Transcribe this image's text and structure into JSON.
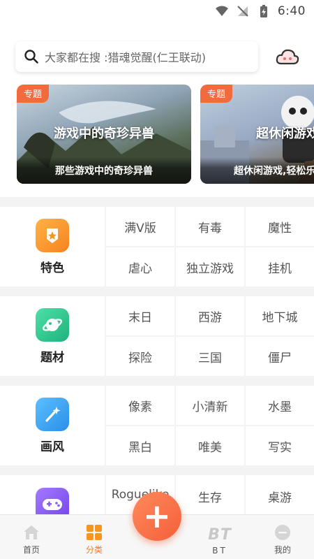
{
  "status_bar": {
    "time": "6:40"
  },
  "search": {
    "placeholder_text": "大家都在搜 :猎魂觉醒(仁王联动)"
  },
  "banners": [
    {
      "tag": "专题",
      "headline": "游戏中的奇珍异兽",
      "caption": "那些游戏中的奇珍异兽"
    },
    {
      "tag": "专题",
      "headline": "超休闲游戏",
      "caption": "超休闲游戏,轻松乐"
    }
  ],
  "sections": [
    {
      "title": "特色",
      "icon": "badge-icon",
      "color": "#f5961f",
      "tags": [
        "满V版",
        "有毒",
        "魔性",
        "虐心",
        "独立游戏",
        "挂机"
      ]
    },
    {
      "title": "题材",
      "icon": "planet-icon",
      "color": "#2cc58f",
      "tags": [
        "末日",
        "西游",
        "地下城",
        "探险",
        "三国",
        "僵尸"
      ]
    },
    {
      "title": "画风",
      "icon": "magic-wand-icon",
      "color": "#3aa0f0",
      "tags": [
        "像素",
        "小清新",
        "水墨",
        "黑白",
        "唯美",
        "写实"
      ]
    },
    {
      "title": "",
      "icon": "gamepad-icon",
      "color": "#8a5cf0",
      "tags": [
        "Roguelike",
        "生存",
        "桌游"
      ]
    }
  ],
  "bottom_nav": {
    "items": [
      {
        "label": "首页",
        "icon": "home-icon"
      },
      {
        "label": "分类",
        "icon": "category-grid-icon",
        "active": true
      },
      {
        "label": "BT",
        "icon": "bt-icon"
      },
      {
        "label": "我的",
        "icon": "profile-icon"
      }
    ],
    "fab": "+"
  },
  "colors": {
    "accent": "#f47a35",
    "tag_bg": "#f26b3d"
  }
}
